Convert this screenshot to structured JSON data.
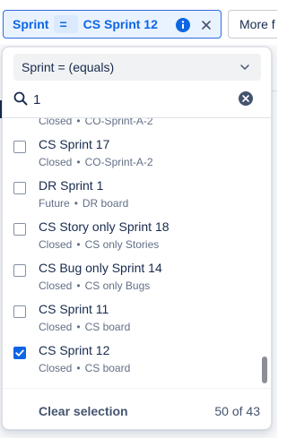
{
  "filter_chip": {
    "field": "Sprint",
    "operator": "=",
    "value": "CS Sprint 12"
  },
  "more_button": {
    "label": "More f"
  },
  "dropdown": {
    "operator_select": {
      "value": "Sprint = (equals)"
    },
    "search": {
      "value": "1"
    },
    "items": [
      {
        "title": "",
        "status": "Closed",
        "board": "CO-Sprint-A-2",
        "checked": false
      },
      {
        "title": "CS Sprint 17",
        "status": "Closed",
        "board": "CO-Sprint-A-2",
        "checked": false
      },
      {
        "title": "DR Sprint 1",
        "status": "Future",
        "board": "DR board",
        "checked": false
      },
      {
        "title": "CS Story only Sprint 18",
        "status": "Closed",
        "board": "CS only Stories",
        "checked": false
      },
      {
        "title": "CS Bug only Sprint 14",
        "status": "Closed",
        "board": "CS only Bugs",
        "checked": false
      },
      {
        "title": "CS Sprint 11",
        "status": "Closed",
        "board": "CS board",
        "checked": false
      },
      {
        "title": "CS Sprint 12",
        "status": "Closed",
        "board": "CS board",
        "checked": true
      }
    ],
    "separator": "•",
    "footer": {
      "clear_label": "Clear selection",
      "count_label": "50 of 43"
    }
  },
  "colors": {
    "accent": "#0c66e4",
    "chip_border": "#2d6cdf",
    "chip_bg": "#e9f2ff",
    "text": "#172b4d",
    "subtext": "#626f86"
  }
}
